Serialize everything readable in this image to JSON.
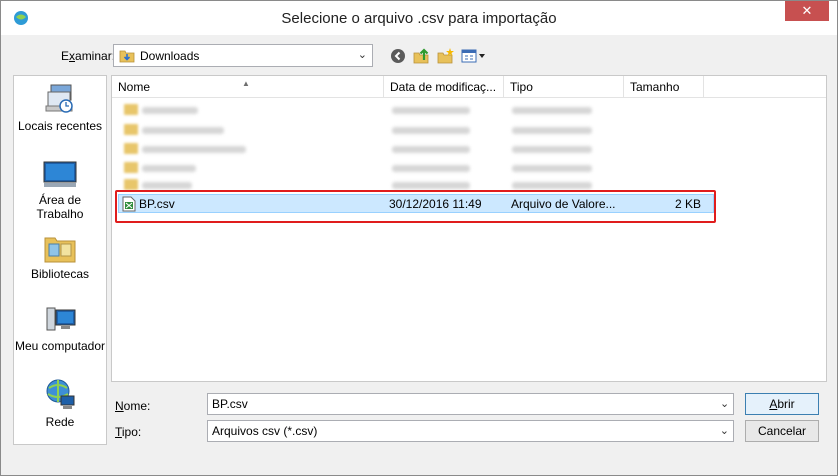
{
  "window": {
    "title": "Selecione o arquivo .csv para importação",
    "close_glyph": "✕"
  },
  "toolbar": {
    "lookin_label_accesskey": "x",
    "lookin_label_pre": "E",
    "lookin_label_post": "aminar:",
    "location": "Downloads",
    "icons": [
      "back-icon",
      "up-folder-icon",
      "new-folder-icon",
      "view-menu-icon"
    ]
  },
  "places": [
    {
      "label": "Locais recentes",
      "icon": "recent-places-icon"
    },
    {
      "label": "Área de Trabalho",
      "icon": "desktop-icon"
    },
    {
      "label": "Bibliotecas",
      "icon": "libraries-icon"
    },
    {
      "label": "Meu computador",
      "icon": "computer-icon"
    },
    {
      "label": "Rede",
      "icon": "network-icon"
    }
  ],
  "columns": [
    "Nome",
    "Data de modificaç...",
    "Tipo",
    "Tamanho"
  ],
  "selected_file": {
    "name": "BP.csv",
    "modified": "30/12/2016 11:49",
    "type": "Arquivo de Valore...",
    "size": "2 KB"
  },
  "footer": {
    "name_label_ul": "N",
    "name_label_rest": "ome:",
    "name_value": "BP.csv",
    "type_label_ul": "T",
    "type_label_rest": "ipo:",
    "type_value": "Arquivos csv (*.csv)",
    "open_ul": "A",
    "open_rest": "brir",
    "cancel": "Cancelar"
  },
  "colors": {
    "selection": "#cce8ff",
    "highlight": "#e01d1d",
    "close": "#c75050"
  }
}
